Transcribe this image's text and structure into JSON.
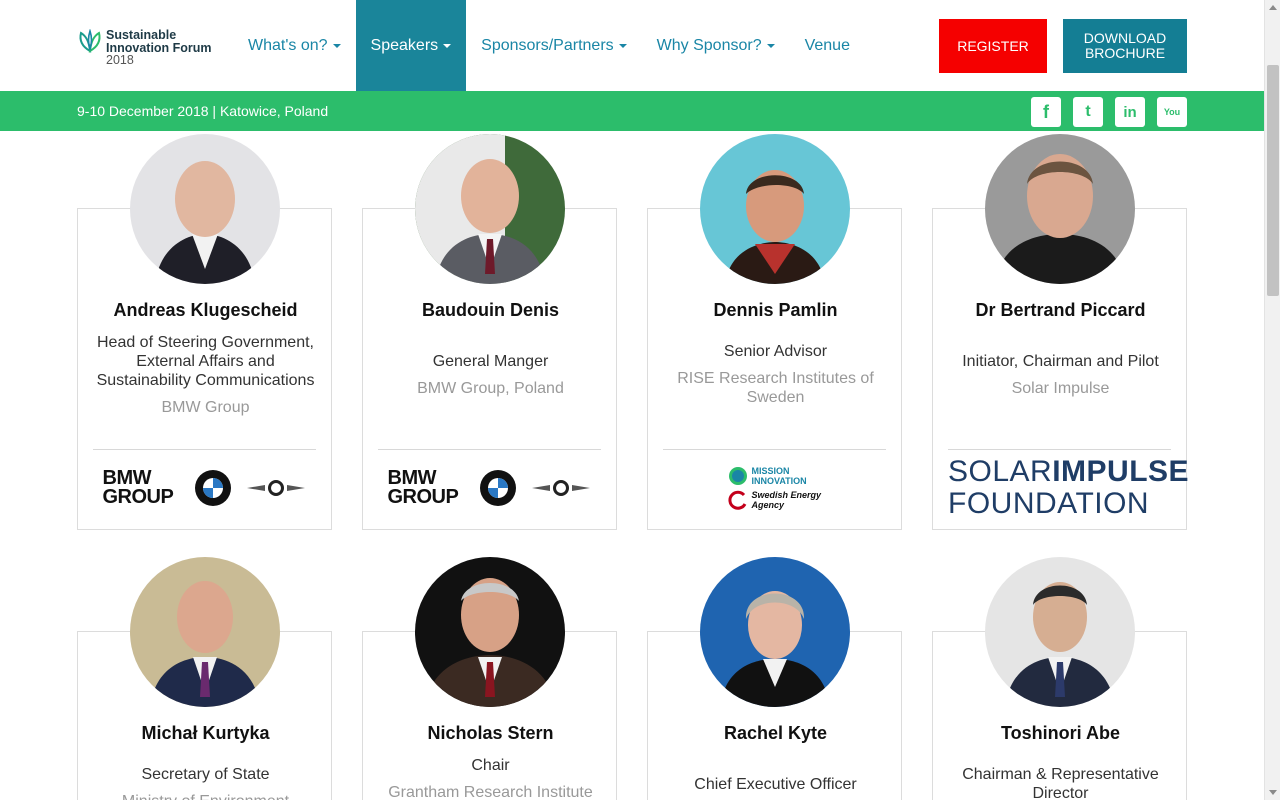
{
  "header": {
    "logo": {
      "line1": "Sustainable",
      "line2": "Innovation Forum",
      "year": "2018"
    },
    "nav": [
      {
        "label": "What's on?",
        "dropdown": true,
        "active": false
      },
      {
        "label": "Speakers",
        "dropdown": true,
        "active": true
      },
      {
        "label": "Sponsors/Partners",
        "dropdown": true,
        "active": false
      },
      {
        "label": "Why Sponsor?",
        "dropdown": true,
        "active": false
      },
      {
        "label": "Venue",
        "dropdown": false,
        "active": false
      }
    ],
    "register_label": "REGISTER",
    "download_label": "DOWNLOAD BROCHURE"
  },
  "event_bar": {
    "date_location": "9-10 December 2018 | Katowice, Poland",
    "socials": [
      {
        "icon": "facebook-icon",
        "glyph": "f"
      },
      {
        "icon": "twitter-icon",
        "glyph": "t"
      },
      {
        "icon": "linkedin-icon",
        "glyph": "in"
      },
      {
        "icon": "youtube-icon",
        "glyph": "You"
      }
    ]
  },
  "speakers": [
    {
      "name": "Andreas Klugescheid",
      "role": "Head of Steering Government, External Affairs and Sustainability Communications",
      "org": "BMW Group",
      "logos": "bmw"
    },
    {
      "name": "Baudouin Denis",
      "role": "General Manger",
      "org": "BMW Group, Poland",
      "logos": "bmw"
    },
    {
      "name": "Dennis Pamlin",
      "role": "Senior Advisor",
      "org": "RISE Research Institutes of Sweden",
      "logos": "mission"
    },
    {
      "name": "Dr Bertrand Piccard",
      "role": "Initiator, Chairman and Pilot",
      "org": "Solar Impulse",
      "logos": "solar"
    },
    {
      "name": "Michał Kurtyka",
      "role": "Secretary of State",
      "org": "Ministry of Environment"
    },
    {
      "name": "Nicholas Stern",
      "role": "Chair",
      "org": "Grantham Research Institute"
    },
    {
      "name": "Rachel Kyte",
      "role": "Chief Executive Officer",
      "org": ""
    },
    {
      "name": "Toshinori Abe",
      "role": "Chairman & Representative Director",
      "org": ""
    }
  ],
  "logo_text": {
    "bmw_group": "BMW GROUP",
    "mission_innovation": "MISSION INNOVATION",
    "swedish_energy": "Swedish Energy Agency",
    "solar_line1a": "SOLAR",
    "solar_line1b": "IMPULSE",
    "solar_line2": "FOUNDATION"
  },
  "colors": {
    "nav_text": "#1a86a6",
    "nav_active_bg": "#1a859a",
    "register_bg": "#f50000",
    "download_bg": "#147e94",
    "green_bar": "#2cbd6b"
  }
}
